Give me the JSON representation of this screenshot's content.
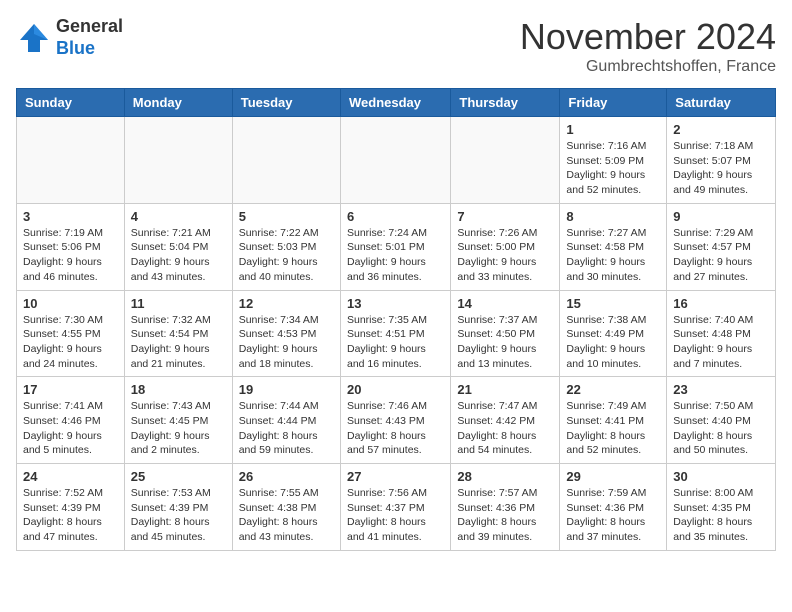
{
  "logo": {
    "general": "General",
    "blue": "Blue"
  },
  "header": {
    "month": "November 2024",
    "location": "Gumbrechtshoffen, France"
  },
  "weekdays": [
    "Sunday",
    "Monday",
    "Tuesday",
    "Wednesday",
    "Thursday",
    "Friday",
    "Saturday"
  ],
  "weeks": [
    [
      {
        "day": "",
        "info": ""
      },
      {
        "day": "",
        "info": ""
      },
      {
        "day": "",
        "info": ""
      },
      {
        "day": "",
        "info": ""
      },
      {
        "day": "",
        "info": ""
      },
      {
        "day": "1",
        "info": "Sunrise: 7:16 AM\nSunset: 5:09 PM\nDaylight: 9 hours and 52 minutes."
      },
      {
        "day": "2",
        "info": "Sunrise: 7:18 AM\nSunset: 5:07 PM\nDaylight: 9 hours and 49 minutes."
      }
    ],
    [
      {
        "day": "3",
        "info": "Sunrise: 7:19 AM\nSunset: 5:06 PM\nDaylight: 9 hours and 46 minutes."
      },
      {
        "day": "4",
        "info": "Sunrise: 7:21 AM\nSunset: 5:04 PM\nDaylight: 9 hours and 43 minutes."
      },
      {
        "day": "5",
        "info": "Sunrise: 7:22 AM\nSunset: 5:03 PM\nDaylight: 9 hours and 40 minutes."
      },
      {
        "day": "6",
        "info": "Sunrise: 7:24 AM\nSunset: 5:01 PM\nDaylight: 9 hours and 36 minutes."
      },
      {
        "day": "7",
        "info": "Sunrise: 7:26 AM\nSunset: 5:00 PM\nDaylight: 9 hours and 33 minutes."
      },
      {
        "day": "8",
        "info": "Sunrise: 7:27 AM\nSunset: 4:58 PM\nDaylight: 9 hours and 30 minutes."
      },
      {
        "day": "9",
        "info": "Sunrise: 7:29 AM\nSunset: 4:57 PM\nDaylight: 9 hours and 27 minutes."
      }
    ],
    [
      {
        "day": "10",
        "info": "Sunrise: 7:30 AM\nSunset: 4:55 PM\nDaylight: 9 hours and 24 minutes."
      },
      {
        "day": "11",
        "info": "Sunrise: 7:32 AM\nSunset: 4:54 PM\nDaylight: 9 hours and 21 minutes."
      },
      {
        "day": "12",
        "info": "Sunrise: 7:34 AM\nSunset: 4:53 PM\nDaylight: 9 hours and 18 minutes."
      },
      {
        "day": "13",
        "info": "Sunrise: 7:35 AM\nSunset: 4:51 PM\nDaylight: 9 hours and 16 minutes."
      },
      {
        "day": "14",
        "info": "Sunrise: 7:37 AM\nSunset: 4:50 PM\nDaylight: 9 hours and 13 minutes."
      },
      {
        "day": "15",
        "info": "Sunrise: 7:38 AM\nSunset: 4:49 PM\nDaylight: 9 hours and 10 minutes."
      },
      {
        "day": "16",
        "info": "Sunrise: 7:40 AM\nSunset: 4:48 PM\nDaylight: 9 hours and 7 minutes."
      }
    ],
    [
      {
        "day": "17",
        "info": "Sunrise: 7:41 AM\nSunset: 4:46 PM\nDaylight: 9 hours and 5 minutes."
      },
      {
        "day": "18",
        "info": "Sunrise: 7:43 AM\nSunset: 4:45 PM\nDaylight: 9 hours and 2 minutes."
      },
      {
        "day": "19",
        "info": "Sunrise: 7:44 AM\nSunset: 4:44 PM\nDaylight: 8 hours and 59 minutes."
      },
      {
        "day": "20",
        "info": "Sunrise: 7:46 AM\nSunset: 4:43 PM\nDaylight: 8 hours and 57 minutes."
      },
      {
        "day": "21",
        "info": "Sunrise: 7:47 AM\nSunset: 4:42 PM\nDaylight: 8 hours and 54 minutes."
      },
      {
        "day": "22",
        "info": "Sunrise: 7:49 AM\nSunset: 4:41 PM\nDaylight: 8 hours and 52 minutes."
      },
      {
        "day": "23",
        "info": "Sunrise: 7:50 AM\nSunset: 4:40 PM\nDaylight: 8 hours and 50 minutes."
      }
    ],
    [
      {
        "day": "24",
        "info": "Sunrise: 7:52 AM\nSunset: 4:39 PM\nDaylight: 8 hours and 47 minutes."
      },
      {
        "day": "25",
        "info": "Sunrise: 7:53 AM\nSunset: 4:39 PM\nDaylight: 8 hours and 45 minutes."
      },
      {
        "day": "26",
        "info": "Sunrise: 7:55 AM\nSunset: 4:38 PM\nDaylight: 8 hours and 43 minutes."
      },
      {
        "day": "27",
        "info": "Sunrise: 7:56 AM\nSunset: 4:37 PM\nDaylight: 8 hours and 41 minutes."
      },
      {
        "day": "28",
        "info": "Sunrise: 7:57 AM\nSunset: 4:36 PM\nDaylight: 8 hours and 39 minutes."
      },
      {
        "day": "29",
        "info": "Sunrise: 7:59 AM\nSunset: 4:36 PM\nDaylight: 8 hours and 37 minutes."
      },
      {
        "day": "30",
        "info": "Sunrise: 8:00 AM\nSunset: 4:35 PM\nDaylight: 8 hours and 35 minutes."
      }
    ]
  ]
}
